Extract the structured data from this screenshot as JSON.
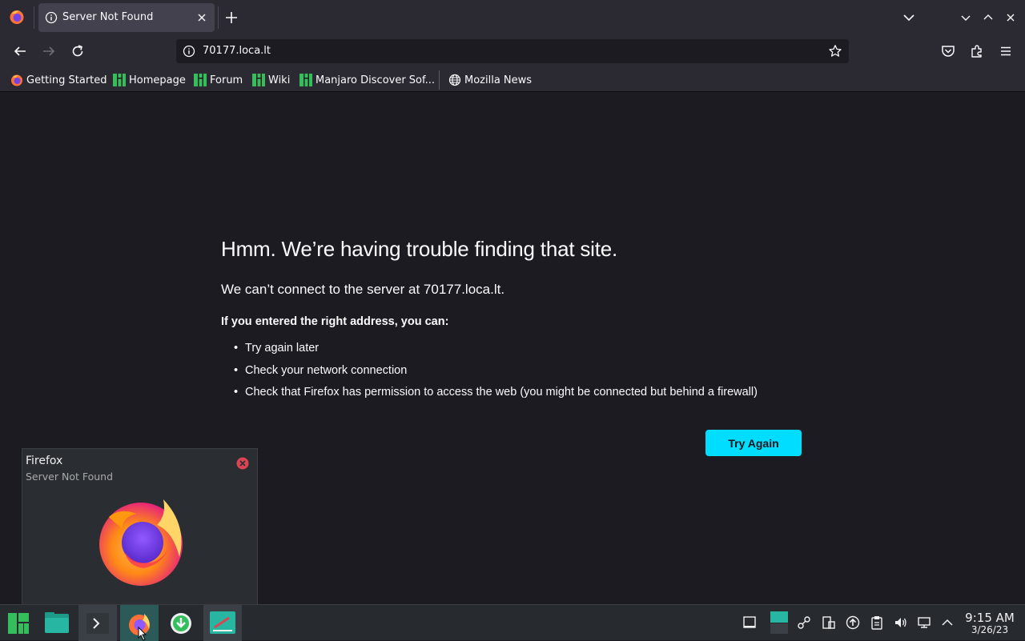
{
  "tab": {
    "title": "Server Not Found"
  },
  "urlbar": {
    "url": "70177.loca.lt"
  },
  "bookmarks": [
    {
      "label": "Getting Started",
      "icon": "firefox-icon"
    },
    {
      "label": "Homepage",
      "icon": "manjaro-icon"
    },
    {
      "label": "Forum",
      "icon": "manjaro-icon"
    },
    {
      "label": "Wiki",
      "icon": "manjaro-icon"
    },
    {
      "label": "Manjaro Discover Sof...",
      "icon": "manjaro-icon"
    },
    {
      "label": "Mozilla News",
      "icon": "globe-icon"
    }
  ],
  "error": {
    "title": "Hmm. We’re having trouble finding that site.",
    "subtitle": "We can’t connect to the server at 70177.loca.lt.",
    "lead": "If you entered the right address, you can:",
    "items": [
      "Try again later",
      "Check your network connection",
      "Check that Firefox has permission to access the web (you might be connected but behind a firewall)"
    ],
    "button": "Try Again"
  },
  "notification": {
    "title": "Firefox",
    "body": "Server Not Found"
  },
  "clock": {
    "time": "9:15 AM",
    "date": "3/26/23"
  },
  "colors": {
    "accent": "#00ddff",
    "page_bg": "#1c1b22",
    "chrome_bg": "#2b2a33",
    "manjaro_green": "#35bf5c"
  }
}
